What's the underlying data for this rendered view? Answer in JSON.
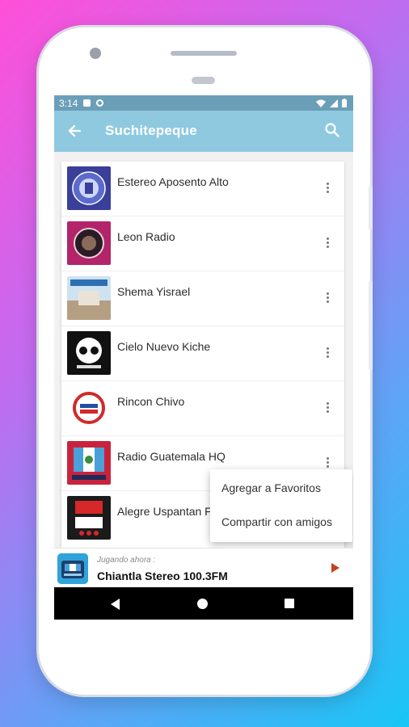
{
  "status_bar": {
    "time": "3:14"
  },
  "app_bar": {
    "title": "Suchitepeque"
  },
  "stations": [
    {
      "name": "Estereo Aposento Alto"
    },
    {
      "name": "Leon Radio"
    },
    {
      "name": "Shema Yisrael"
    },
    {
      "name": "Cielo Nuevo Kiche"
    },
    {
      "name": "Rincon Chivo"
    },
    {
      "name": "Radio Guatemala HQ"
    },
    {
      "name": "Alegre Uspantan FM"
    }
  ],
  "context_menu": {
    "items": [
      "Agregar a Favoritos",
      "Compartir con amigos"
    ]
  },
  "now_playing": {
    "label": "Jugando ahora :",
    "station": "Chiantla Stereo 100.3FM"
  },
  "colors": {
    "app_bar": "#8fc9e0",
    "status_bar": "#6b9fb8",
    "play_button": "#c2421f"
  }
}
